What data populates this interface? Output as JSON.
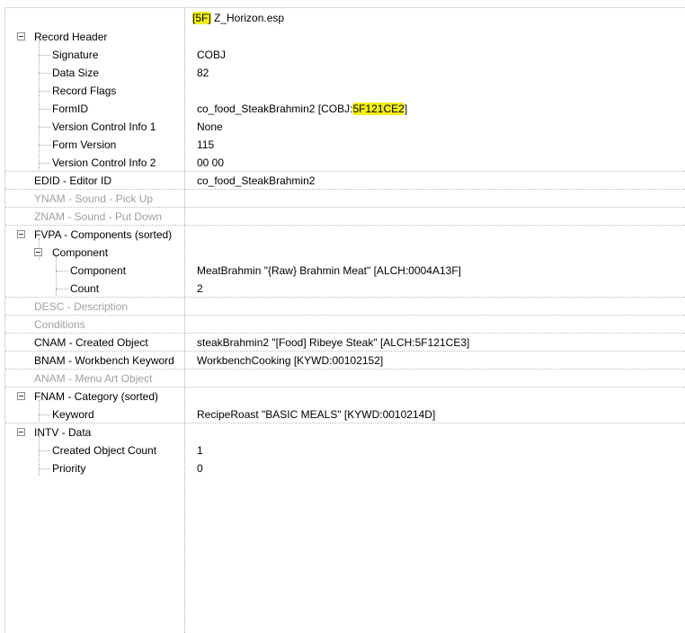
{
  "header": {
    "plugin_prefix": "[5F]",
    "plugin_name": "Z_Horizon.esp"
  },
  "rows": [
    {
      "label": "Record Header",
      "value": ""
    },
    {
      "label": "Signature",
      "value": "COBJ"
    },
    {
      "label": "Data Size",
      "value": "82"
    },
    {
      "label": "Record Flags",
      "value": ""
    },
    {
      "label": "FormID",
      "value": "co_food_SteakBrahmin2 [COBJ:",
      "value_highlight": "5F121CE2",
      "value_tail": "]"
    },
    {
      "label": "Version Control Info 1",
      "value": "None"
    },
    {
      "label": "Form Version",
      "value": "115"
    },
    {
      "label": "Version Control Info 2",
      "value": "00 00"
    },
    {
      "label": "EDID - Editor ID",
      "value": "co_food_SteakBrahmin2"
    },
    {
      "label": "YNAM - Sound - Pick Up",
      "value": ""
    },
    {
      "label": "ZNAM - Sound - Put Down",
      "value": ""
    },
    {
      "label": "FVPA - Components (sorted)",
      "value": ""
    },
    {
      "label": "Component",
      "value": ""
    },
    {
      "label": "Component",
      "value": "MeatBrahmin \"{Raw} Brahmin Meat\" [ALCH:0004A13F]"
    },
    {
      "label": "Count",
      "value": "2"
    },
    {
      "label": "DESC - Description",
      "value": ""
    },
    {
      "label": "Conditions",
      "value": ""
    },
    {
      "label": "CNAM - Created Object",
      "value": "steakBrahmin2 \"[Food] Ribeye Steak\" [ALCH:5F121CE3]"
    },
    {
      "label": "BNAM - Workbench Keyword",
      "value": "WorkbenchCooking [KYWD:00102152]"
    },
    {
      "label": "ANAM - Menu Art Object",
      "value": ""
    },
    {
      "label": "FNAM - Category (sorted)",
      "value": ""
    },
    {
      "label": "Keyword",
      "value": "RecipeRoast \"BASIC MEALS\" [KYWD:0010214D]"
    },
    {
      "label": "INTV - Data",
      "value": ""
    },
    {
      "label": "Created Object Count",
      "value": "1"
    },
    {
      "label": "Priority",
      "value": "0"
    }
  ],
  "colors": {
    "highlight": "#f3ef1a",
    "disabled_text": "#a0a0a0",
    "separator": "#bdbdbd"
  }
}
